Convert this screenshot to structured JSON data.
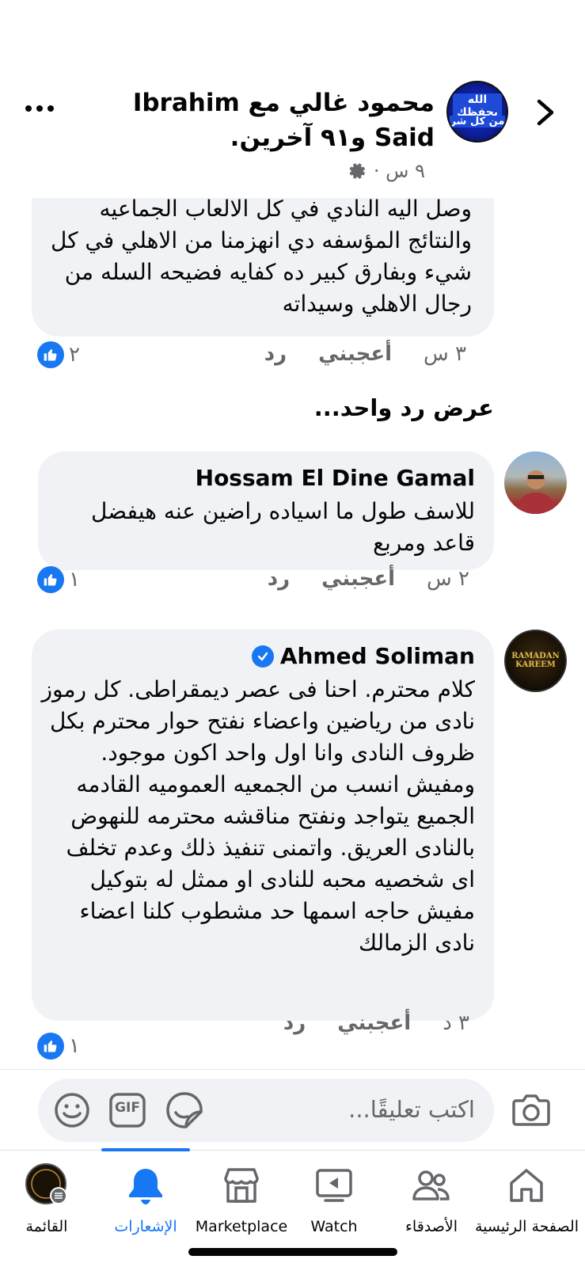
{
  "header": {
    "title": "محمود غالي مع Ibrahim Said و٩١ آخرين.",
    "time": "٩ س ·",
    "avatar_text_line1": "الله يحفظك",
    "avatar_text_line2": "من كل شر"
  },
  "comments": [
    {
      "author": "",
      "text": "وصل اليه النادي في كل الالعاب الجماعيه والنتائج المؤسفه دي انهزمنا من الاهلي في كل شيء وبفارق كبير ده كفايه فضيحه السله من رجال الاهلي وسيداته",
      "time": "٣ س",
      "like_label": "أعجبني",
      "reply_label": "رد",
      "like_count": "٢"
    },
    {
      "author": "Hossam El Dine Gamal",
      "text": "للاسف طول ما اسياده راضين عنه هيفضل قاعد ومربع",
      "time": "٢ س",
      "like_label": "أعجبني",
      "reply_label": "رد",
      "like_count": "١"
    },
    {
      "author": "Ahmed Soliman",
      "verified": true,
      "text": "كلام محترم.  احنا فى عصر ديمقراطى. كل رموز نادى من رياضين واعضاء نفتح حوار محترم بكل ظروف النادى وانا اول واحد اكون موجود. ومفيش انسب من الجمعيه العموميه القادمه الجميع يتواجد ونفتح مناقشه محترمه للنهوض بالنادى العريق. واتمنى تنفيذ ذلك وعدم تخلف اى شخصيه محبه للنادى او ممثل له بتوكيل مفيش حاجه اسمها حد مشطوب كلنا اعضاء نادى الزمالك",
      "time": "٣ د",
      "like_label": "أعجبني",
      "reply_label": "رد",
      "like_count": "١",
      "avatar_text": "RAMADAN KAREEM"
    }
  ],
  "view_replies": "عرض رد واحد...",
  "composer": {
    "placeholder": "اكتب تعليقًا...",
    "gif_label": "GIF"
  },
  "nav": {
    "items": [
      {
        "label": "الصفحة الرئيسية",
        "icon": "home-icon"
      },
      {
        "label": "الأصدقاء",
        "icon": "friends-icon"
      },
      {
        "label": "Watch",
        "icon": "watch-icon"
      },
      {
        "label": "Marketplace",
        "icon": "marketplace-icon"
      },
      {
        "label": "الإشعارات",
        "icon": "bell-icon",
        "active": true
      },
      {
        "label": "القائمة",
        "icon": "menu-avatar-icon"
      }
    ],
    "accent": "#1877f2"
  }
}
